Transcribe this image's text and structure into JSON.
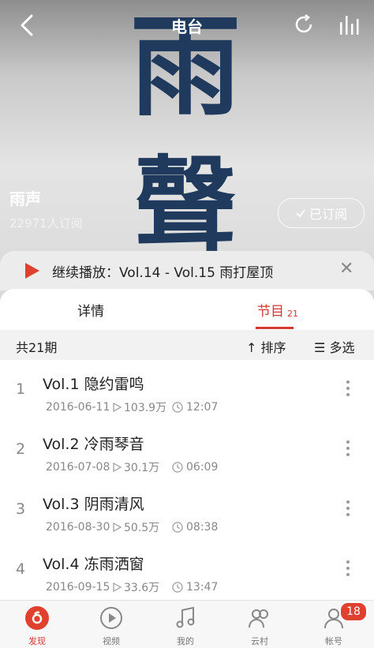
{
  "header": {
    "title": "电台"
  },
  "hero": {
    "art_char_1": "雨",
    "art_char_2": "聲",
    "station_name": "雨声",
    "subscribers": "22971人订阅",
    "subscribe_button": "已订阅"
  },
  "continue_bar": {
    "text": "继续播放：Vol.14 - Vol.15 雨打屋顶"
  },
  "tabs": {
    "detail": "详情",
    "programs": "节目",
    "programs_count": "21"
  },
  "list_header": {
    "count": "共21期",
    "sort": "排序",
    "multi_select": "多选"
  },
  "episodes": [
    {
      "index": "1",
      "title": "Vol.1 隐约雷鸣",
      "date": "2016-06-11",
      "plays": "103.9万",
      "duration": "12:07"
    },
    {
      "index": "2",
      "title": "Vol.2 冷雨琴音",
      "date": "2016-07-08",
      "plays": "30.1万",
      "duration": "06:09"
    },
    {
      "index": "3",
      "title": "Vol.3 阴雨清风",
      "date": "2016-08-30",
      "plays": "50.5万",
      "duration": "08:38"
    },
    {
      "index": "4",
      "title": "Vol.4 冻雨洒窗",
      "date": "2016-09-15",
      "plays": "33.6万",
      "duration": "13:47"
    }
  ],
  "bottom_nav": [
    {
      "label": "发现",
      "icon": "discover-icon",
      "active": true
    },
    {
      "label": "视频",
      "icon": "video-icon",
      "active": false
    },
    {
      "label": "我的",
      "icon": "music-icon",
      "active": false
    },
    {
      "label": "云村",
      "icon": "community-icon",
      "active": false
    },
    {
      "label": "帐号",
      "icon": "account-icon",
      "active": false
    }
  ],
  "account_badge": "18",
  "colors": {
    "accent": "#d33a31",
    "play": "#e0412f"
  }
}
